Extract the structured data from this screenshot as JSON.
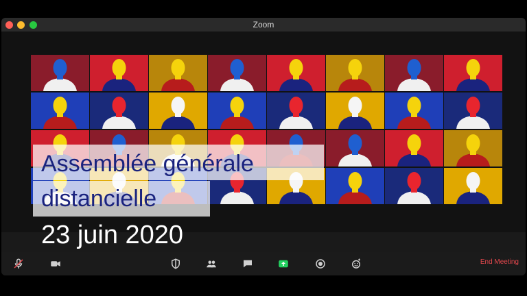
{
  "window": {
    "title": "Zoom"
  },
  "overlay": {
    "line1": "Assemblée générale",
    "line2": "distancielle",
    "date": "23 juin 2020"
  },
  "toolbar": {
    "end_label": "End Meeting",
    "icons": [
      "microphone-muted-icon",
      "video-camera-icon",
      "shield-icon",
      "participants-icon",
      "chat-icon",
      "share-screen-icon",
      "record-icon",
      "reactions-icon"
    ]
  },
  "colors": {
    "overlay_text": "#1a237e",
    "end_meeting": "#e5484d",
    "share_green": "#23d160"
  }
}
